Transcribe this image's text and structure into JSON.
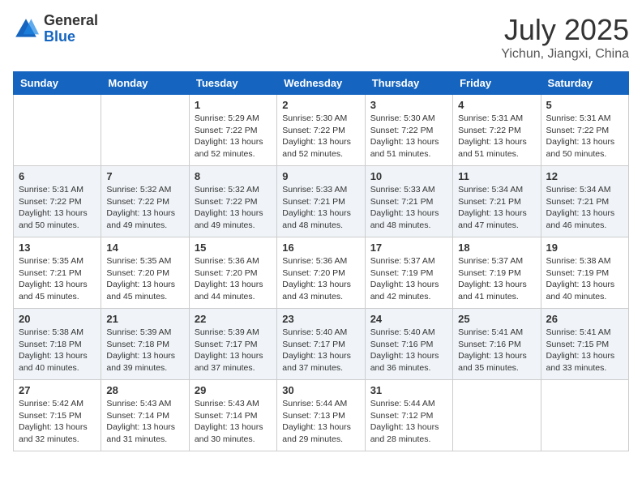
{
  "logo": {
    "general": "General",
    "blue": "Blue"
  },
  "title": {
    "month": "July 2025",
    "location": "Yichun, Jiangxi, China"
  },
  "days_of_week": [
    "Sunday",
    "Monday",
    "Tuesday",
    "Wednesday",
    "Thursday",
    "Friday",
    "Saturday"
  ],
  "weeks": [
    [
      {
        "day": "",
        "info": ""
      },
      {
        "day": "",
        "info": ""
      },
      {
        "day": "1",
        "info": "Sunrise: 5:29 AM\nSunset: 7:22 PM\nDaylight: 13 hours and 52 minutes."
      },
      {
        "day": "2",
        "info": "Sunrise: 5:30 AM\nSunset: 7:22 PM\nDaylight: 13 hours and 52 minutes."
      },
      {
        "day": "3",
        "info": "Sunrise: 5:30 AM\nSunset: 7:22 PM\nDaylight: 13 hours and 51 minutes."
      },
      {
        "day": "4",
        "info": "Sunrise: 5:31 AM\nSunset: 7:22 PM\nDaylight: 13 hours and 51 minutes."
      },
      {
        "day": "5",
        "info": "Sunrise: 5:31 AM\nSunset: 7:22 PM\nDaylight: 13 hours and 50 minutes."
      }
    ],
    [
      {
        "day": "6",
        "info": "Sunrise: 5:31 AM\nSunset: 7:22 PM\nDaylight: 13 hours and 50 minutes."
      },
      {
        "day": "7",
        "info": "Sunrise: 5:32 AM\nSunset: 7:22 PM\nDaylight: 13 hours and 49 minutes."
      },
      {
        "day": "8",
        "info": "Sunrise: 5:32 AM\nSunset: 7:22 PM\nDaylight: 13 hours and 49 minutes."
      },
      {
        "day": "9",
        "info": "Sunrise: 5:33 AM\nSunset: 7:21 PM\nDaylight: 13 hours and 48 minutes."
      },
      {
        "day": "10",
        "info": "Sunrise: 5:33 AM\nSunset: 7:21 PM\nDaylight: 13 hours and 48 minutes."
      },
      {
        "day": "11",
        "info": "Sunrise: 5:34 AM\nSunset: 7:21 PM\nDaylight: 13 hours and 47 minutes."
      },
      {
        "day": "12",
        "info": "Sunrise: 5:34 AM\nSunset: 7:21 PM\nDaylight: 13 hours and 46 minutes."
      }
    ],
    [
      {
        "day": "13",
        "info": "Sunrise: 5:35 AM\nSunset: 7:21 PM\nDaylight: 13 hours and 45 minutes."
      },
      {
        "day": "14",
        "info": "Sunrise: 5:35 AM\nSunset: 7:20 PM\nDaylight: 13 hours and 45 minutes."
      },
      {
        "day": "15",
        "info": "Sunrise: 5:36 AM\nSunset: 7:20 PM\nDaylight: 13 hours and 44 minutes."
      },
      {
        "day": "16",
        "info": "Sunrise: 5:36 AM\nSunset: 7:20 PM\nDaylight: 13 hours and 43 minutes."
      },
      {
        "day": "17",
        "info": "Sunrise: 5:37 AM\nSunset: 7:19 PM\nDaylight: 13 hours and 42 minutes."
      },
      {
        "day": "18",
        "info": "Sunrise: 5:37 AM\nSunset: 7:19 PM\nDaylight: 13 hours and 41 minutes."
      },
      {
        "day": "19",
        "info": "Sunrise: 5:38 AM\nSunset: 7:19 PM\nDaylight: 13 hours and 40 minutes."
      }
    ],
    [
      {
        "day": "20",
        "info": "Sunrise: 5:38 AM\nSunset: 7:18 PM\nDaylight: 13 hours and 40 minutes."
      },
      {
        "day": "21",
        "info": "Sunrise: 5:39 AM\nSunset: 7:18 PM\nDaylight: 13 hours and 39 minutes."
      },
      {
        "day": "22",
        "info": "Sunrise: 5:39 AM\nSunset: 7:17 PM\nDaylight: 13 hours and 37 minutes."
      },
      {
        "day": "23",
        "info": "Sunrise: 5:40 AM\nSunset: 7:17 PM\nDaylight: 13 hours and 37 minutes."
      },
      {
        "day": "24",
        "info": "Sunrise: 5:40 AM\nSunset: 7:16 PM\nDaylight: 13 hours and 36 minutes."
      },
      {
        "day": "25",
        "info": "Sunrise: 5:41 AM\nSunset: 7:16 PM\nDaylight: 13 hours and 35 minutes."
      },
      {
        "day": "26",
        "info": "Sunrise: 5:41 AM\nSunset: 7:15 PM\nDaylight: 13 hours and 33 minutes."
      }
    ],
    [
      {
        "day": "27",
        "info": "Sunrise: 5:42 AM\nSunset: 7:15 PM\nDaylight: 13 hours and 32 minutes."
      },
      {
        "day": "28",
        "info": "Sunrise: 5:43 AM\nSunset: 7:14 PM\nDaylight: 13 hours and 31 minutes."
      },
      {
        "day": "29",
        "info": "Sunrise: 5:43 AM\nSunset: 7:14 PM\nDaylight: 13 hours and 30 minutes."
      },
      {
        "day": "30",
        "info": "Sunrise: 5:44 AM\nSunset: 7:13 PM\nDaylight: 13 hours and 29 minutes."
      },
      {
        "day": "31",
        "info": "Sunrise: 5:44 AM\nSunset: 7:12 PM\nDaylight: 13 hours and 28 minutes."
      },
      {
        "day": "",
        "info": ""
      },
      {
        "day": "",
        "info": ""
      }
    ]
  ]
}
